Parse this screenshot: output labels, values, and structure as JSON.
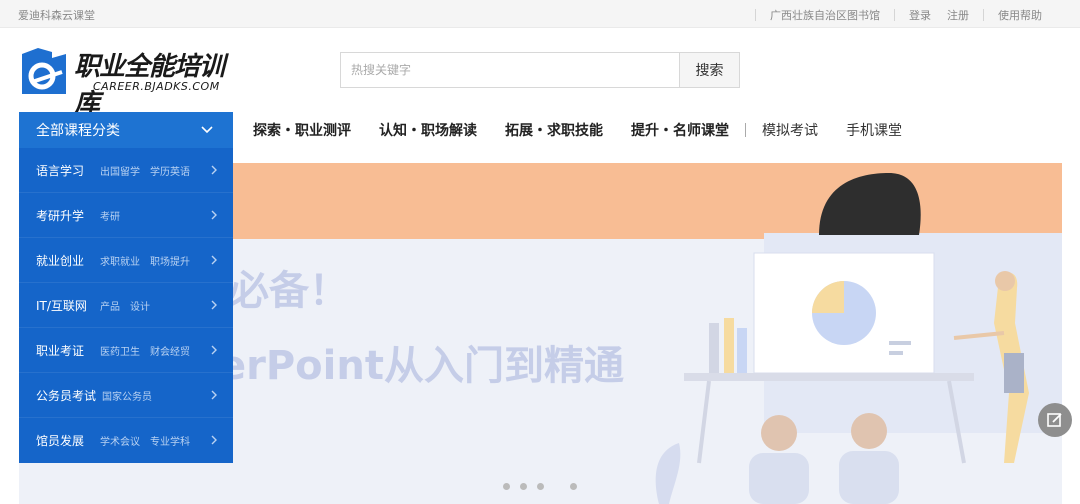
{
  "topbar": {
    "brand": "爱迪科森云课堂",
    "library": "广西壮族自治区图书馆",
    "login": "登录",
    "register": "注册",
    "help": "使用帮助"
  },
  "logo": {
    "title": "职业全能培训库",
    "subtitle": "CAREER.BJADKS.COM"
  },
  "search": {
    "placeholder": "热搜关键字",
    "button": "搜索"
  },
  "nav": {
    "category_label": "全部课程分类",
    "links": [
      "探索・职业测评",
      "认知・职场解读",
      "拓展・求职技能",
      "提升・名师课堂",
      "模拟考试",
      "手机课堂"
    ]
  },
  "sidebar": {
    "items": [
      {
        "name": "语言学习",
        "subs": [
          "出国留学",
          "学历英语"
        ]
      },
      {
        "name": "考研升学",
        "subs": [
          "考研"
        ]
      },
      {
        "name": "就业创业",
        "subs": [
          "求职就业",
          "职场提升"
        ]
      },
      {
        "name": "IT/互联网",
        "subs": [
          "产品",
          "设计"
        ]
      },
      {
        "name": "职业考证",
        "subs": [
          "医药卫生",
          "财会经贸"
        ]
      },
      {
        "name": "公务员考试",
        "subs": [
          "国家公务员"
        ]
      },
      {
        "name": "馆员发展",
        "subs": [
          "学术会议",
          "专业学科"
        ]
      }
    ]
  },
  "banner": {
    "line1": "必备！",
    "line2": "erPoint从入门到精通"
  },
  "colors": {
    "accent": "#1e73d2",
    "sidebar": "#1565c9",
    "banner_orange": "#f8bd94"
  }
}
